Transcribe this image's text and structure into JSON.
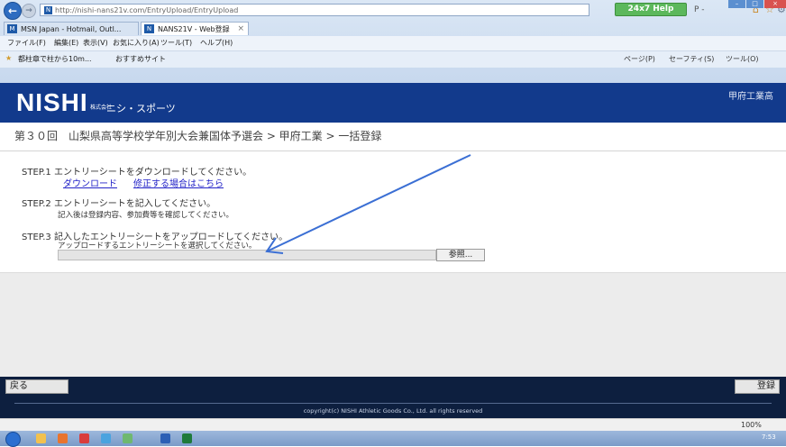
{
  "browser": {
    "url": "http://nishi-nans21v.com/EntryUpload/EntryUpload",
    "help_badge": "24x7 Help",
    "search_placeholder": "P -",
    "tabs": [
      {
        "label": "MSN Japan - Hotmail, Outl..."
      },
      {
        "label": "NANS21V - Web登録",
        "close": "×"
      }
    ],
    "menu": [
      "ファイル(F)",
      "編集(E)",
      "表示(V)",
      "お気に入り(A)",
      "ツール(T)",
      "ヘルプ(H)"
    ],
    "favorites": [
      "都柱章で柱から10m...",
      "おすすめサイト"
    ],
    "commands": [
      "ページ(P)",
      "セーフティ(S)",
      "ツール(O)"
    ],
    "status_zoom": "100%",
    "clock": "7:53"
  },
  "site": {
    "logo": "NISHI",
    "logo_small": "株式会社",
    "logo_subtitle": "ニシ・スポーツ",
    "header_right": "甲府工業高"
  },
  "breadcrumb": "第３０回　山梨県高等学校学年別大会兼国体予選会 > 甲府工業 > 一括登録",
  "steps": {
    "step1": {
      "label": "STEP.1 エントリーシートをダウンロードしてください。",
      "link_download": "ダウンロード",
      "link_fix": "修正する場合はこちら"
    },
    "step2": {
      "label": "STEP.2 エントリーシートを記入してください。",
      "note": "記入後は登録内容、参加費等を確認してください。"
    },
    "step3": {
      "label": "STEP.3 記入したエントリーシートをアップロードしてください。",
      "note": "アップロードするエントリーシートを選択してください。",
      "browse_label": "参照..."
    }
  },
  "footer": {
    "back_label": "戻る",
    "register_label": "登録",
    "copyright": "copyright(c) NISHI Athletic Goods Co., Ltd. all rights reserved"
  }
}
